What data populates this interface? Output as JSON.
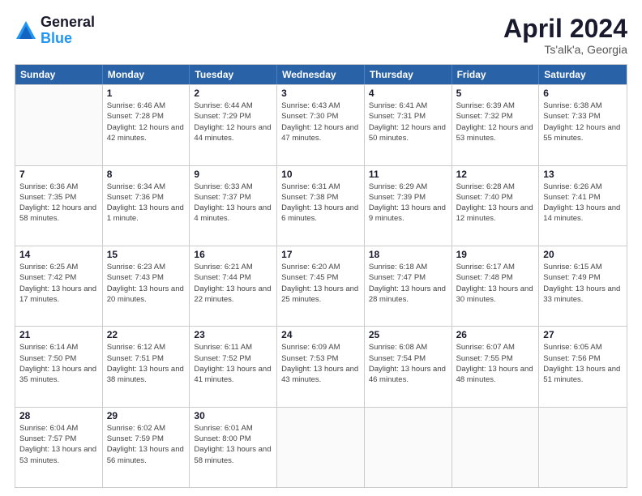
{
  "header": {
    "logo_line1": "General",
    "logo_line2": "Blue",
    "month": "April 2024",
    "location": "Ts'alk'a, Georgia"
  },
  "days_of_week": [
    "Sunday",
    "Monday",
    "Tuesday",
    "Wednesday",
    "Thursday",
    "Friday",
    "Saturday"
  ],
  "weeks": [
    [
      {
        "day": "",
        "sunrise": "",
        "sunset": "",
        "daylight": ""
      },
      {
        "day": "1",
        "sunrise": "Sunrise: 6:46 AM",
        "sunset": "Sunset: 7:28 PM",
        "daylight": "Daylight: 12 hours and 42 minutes."
      },
      {
        "day": "2",
        "sunrise": "Sunrise: 6:44 AM",
        "sunset": "Sunset: 7:29 PM",
        "daylight": "Daylight: 12 hours and 44 minutes."
      },
      {
        "day": "3",
        "sunrise": "Sunrise: 6:43 AM",
        "sunset": "Sunset: 7:30 PM",
        "daylight": "Daylight: 12 hours and 47 minutes."
      },
      {
        "day": "4",
        "sunrise": "Sunrise: 6:41 AM",
        "sunset": "Sunset: 7:31 PM",
        "daylight": "Daylight: 12 hours and 50 minutes."
      },
      {
        "day": "5",
        "sunrise": "Sunrise: 6:39 AM",
        "sunset": "Sunset: 7:32 PM",
        "daylight": "Daylight: 12 hours and 53 minutes."
      },
      {
        "day": "6",
        "sunrise": "Sunrise: 6:38 AM",
        "sunset": "Sunset: 7:33 PM",
        "daylight": "Daylight: 12 hours and 55 minutes."
      }
    ],
    [
      {
        "day": "7",
        "sunrise": "Sunrise: 6:36 AM",
        "sunset": "Sunset: 7:35 PM",
        "daylight": "Daylight: 12 hours and 58 minutes."
      },
      {
        "day": "8",
        "sunrise": "Sunrise: 6:34 AM",
        "sunset": "Sunset: 7:36 PM",
        "daylight": "Daylight: 13 hours and 1 minute."
      },
      {
        "day": "9",
        "sunrise": "Sunrise: 6:33 AM",
        "sunset": "Sunset: 7:37 PM",
        "daylight": "Daylight: 13 hours and 4 minutes."
      },
      {
        "day": "10",
        "sunrise": "Sunrise: 6:31 AM",
        "sunset": "Sunset: 7:38 PM",
        "daylight": "Daylight: 13 hours and 6 minutes."
      },
      {
        "day": "11",
        "sunrise": "Sunrise: 6:29 AM",
        "sunset": "Sunset: 7:39 PM",
        "daylight": "Daylight: 13 hours and 9 minutes."
      },
      {
        "day": "12",
        "sunrise": "Sunrise: 6:28 AM",
        "sunset": "Sunset: 7:40 PM",
        "daylight": "Daylight: 13 hours and 12 minutes."
      },
      {
        "day": "13",
        "sunrise": "Sunrise: 6:26 AM",
        "sunset": "Sunset: 7:41 PM",
        "daylight": "Daylight: 13 hours and 14 minutes."
      }
    ],
    [
      {
        "day": "14",
        "sunrise": "Sunrise: 6:25 AM",
        "sunset": "Sunset: 7:42 PM",
        "daylight": "Daylight: 13 hours and 17 minutes."
      },
      {
        "day": "15",
        "sunrise": "Sunrise: 6:23 AM",
        "sunset": "Sunset: 7:43 PM",
        "daylight": "Daylight: 13 hours and 20 minutes."
      },
      {
        "day": "16",
        "sunrise": "Sunrise: 6:21 AM",
        "sunset": "Sunset: 7:44 PM",
        "daylight": "Daylight: 13 hours and 22 minutes."
      },
      {
        "day": "17",
        "sunrise": "Sunrise: 6:20 AM",
        "sunset": "Sunset: 7:45 PM",
        "daylight": "Daylight: 13 hours and 25 minutes."
      },
      {
        "day": "18",
        "sunrise": "Sunrise: 6:18 AM",
        "sunset": "Sunset: 7:47 PM",
        "daylight": "Daylight: 13 hours and 28 minutes."
      },
      {
        "day": "19",
        "sunrise": "Sunrise: 6:17 AM",
        "sunset": "Sunset: 7:48 PM",
        "daylight": "Daylight: 13 hours and 30 minutes."
      },
      {
        "day": "20",
        "sunrise": "Sunrise: 6:15 AM",
        "sunset": "Sunset: 7:49 PM",
        "daylight": "Daylight: 13 hours and 33 minutes."
      }
    ],
    [
      {
        "day": "21",
        "sunrise": "Sunrise: 6:14 AM",
        "sunset": "Sunset: 7:50 PM",
        "daylight": "Daylight: 13 hours and 35 minutes."
      },
      {
        "day": "22",
        "sunrise": "Sunrise: 6:12 AM",
        "sunset": "Sunset: 7:51 PM",
        "daylight": "Daylight: 13 hours and 38 minutes."
      },
      {
        "day": "23",
        "sunrise": "Sunrise: 6:11 AM",
        "sunset": "Sunset: 7:52 PM",
        "daylight": "Daylight: 13 hours and 41 minutes."
      },
      {
        "day": "24",
        "sunrise": "Sunrise: 6:09 AM",
        "sunset": "Sunset: 7:53 PM",
        "daylight": "Daylight: 13 hours and 43 minutes."
      },
      {
        "day": "25",
        "sunrise": "Sunrise: 6:08 AM",
        "sunset": "Sunset: 7:54 PM",
        "daylight": "Daylight: 13 hours and 46 minutes."
      },
      {
        "day": "26",
        "sunrise": "Sunrise: 6:07 AM",
        "sunset": "Sunset: 7:55 PM",
        "daylight": "Daylight: 13 hours and 48 minutes."
      },
      {
        "day": "27",
        "sunrise": "Sunrise: 6:05 AM",
        "sunset": "Sunset: 7:56 PM",
        "daylight": "Daylight: 13 hours and 51 minutes."
      }
    ],
    [
      {
        "day": "28",
        "sunrise": "Sunrise: 6:04 AM",
        "sunset": "Sunset: 7:57 PM",
        "daylight": "Daylight: 13 hours and 53 minutes."
      },
      {
        "day": "29",
        "sunrise": "Sunrise: 6:02 AM",
        "sunset": "Sunset: 7:59 PM",
        "daylight": "Daylight: 13 hours and 56 minutes."
      },
      {
        "day": "30",
        "sunrise": "Sunrise: 6:01 AM",
        "sunset": "Sunset: 8:00 PM",
        "daylight": "Daylight: 13 hours and 58 minutes."
      },
      {
        "day": "",
        "sunrise": "",
        "sunset": "",
        "daylight": ""
      },
      {
        "day": "",
        "sunrise": "",
        "sunset": "",
        "daylight": ""
      },
      {
        "day": "",
        "sunrise": "",
        "sunset": "",
        "daylight": ""
      },
      {
        "day": "",
        "sunrise": "",
        "sunset": "",
        "daylight": ""
      }
    ]
  ]
}
